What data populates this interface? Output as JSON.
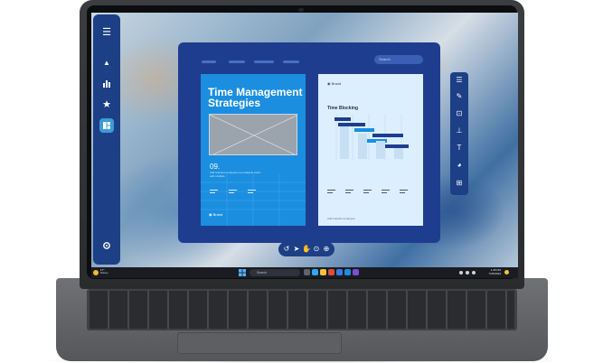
{
  "sidebar": {
    "items": [
      {
        "icon": "menu-icon",
        "glyph": "☰"
      },
      {
        "icon": "triangle-icon",
        "glyph": "▲"
      },
      {
        "icon": "bar-chart-icon",
        "glyph": "▮"
      },
      {
        "icon": "star-icon",
        "glyph": "★"
      },
      {
        "icon": "layout-icon",
        "glyph": "▚"
      },
      {
        "icon": "gear-icon",
        "glyph": "✺"
      }
    ]
  },
  "app": {
    "search_placeholder": "Search",
    "slide_left": {
      "title": "Time Management Strategies",
      "number": "09.",
      "body": "Add relevant employee use analysis exam with multiple",
      "logo": "Brand"
    },
    "slide_right": {
      "logo": "Brand",
      "title": "Time Blocking",
      "footer": "Add relevant employee"
    }
  },
  "right_toolbar": {
    "items": [
      "list-icon",
      "pen-icon",
      "crop-icon",
      "align-icon",
      "text-icon",
      "pie-chart-icon",
      "transform-icon"
    ]
  },
  "bottom_toolbar": {
    "items": [
      "undo-icon",
      "pointer-icon",
      "hand-icon",
      "play-icon",
      "add-icon"
    ]
  },
  "taskbar": {
    "weather": "17°",
    "weather_desc": "Sunny",
    "search_placeholder": "Search",
    "time": "1:45 PM",
    "date": "7/25/2024"
  },
  "colors": {
    "sidebar": "#1d3f86",
    "app_window": "#1e3d8f",
    "accent": "#1b8ee0",
    "slide_light": "#dcefff"
  }
}
